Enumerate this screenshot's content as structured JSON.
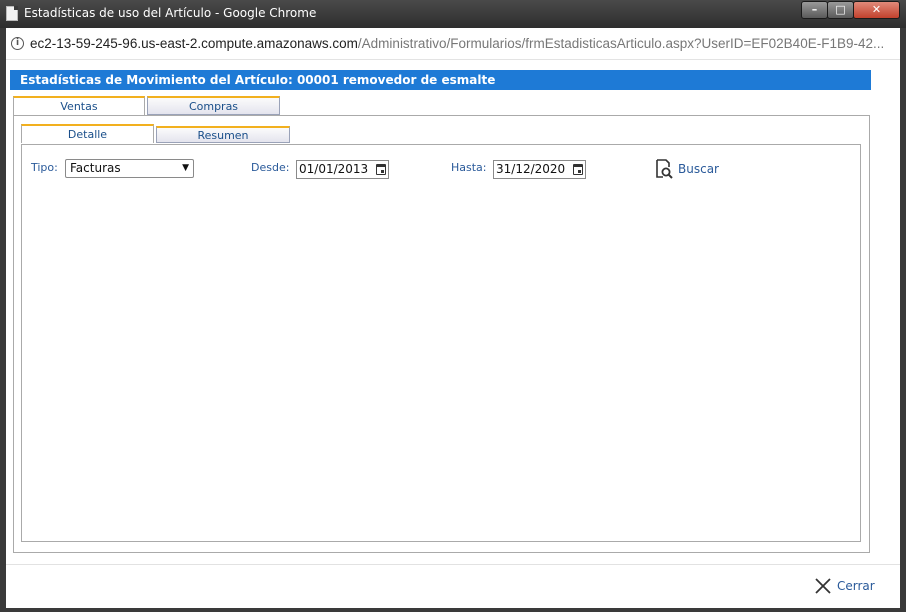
{
  "window": {
    "title": "Estadísticas de uso del Artículo - Google Chrome",
    "url_host": "ec2-13-59-245-96.us-east-2.compute.amazonaws.com",
    "url_path": "/Administrativo/Formularios/frmEstadisticasArticulo.aspx?UserID=EF02B40E-F1B9-42..."
  },
  "header": {
    "title": "Estadísticas de Movimiento del Artículo: 00001 removedor de esmalte"
  },
  "outer_tabs": [
    {
      "label": "Ventas",
      "active": true
    },
    {
      "label": "Compras",
      "active": false
    }
  ],
  "inner_tabs": [
    {
      "label": "Detalle",
      "active": true
    },
    {
      "label": "Resumen",
      "active": false
    }
  ],
  "filters": {
    "tipo_label": "Tipo:",
    "tipo_value": "Facturas",
    "desde_label": "Desde:",
    "desde_value": "01/01/2013",
    "hasta_label": "Hasta:",
    "hasta_value": "31/12/2020",
    "search_label": "Buscar"
  },
  "footer": {
    "close_label": "Cerrar"
  },
  "colors": {
    "header_bg": "#1e7ad6",
    "tab_accent": "#f2b01e",
    "link": "#2a5a9a"
  },
  "icons": {
    "info": "info-icon",
    "calendar": "calendar-icon",
    "search": "search-icon",
    "close": "close-icon"
  }
}
